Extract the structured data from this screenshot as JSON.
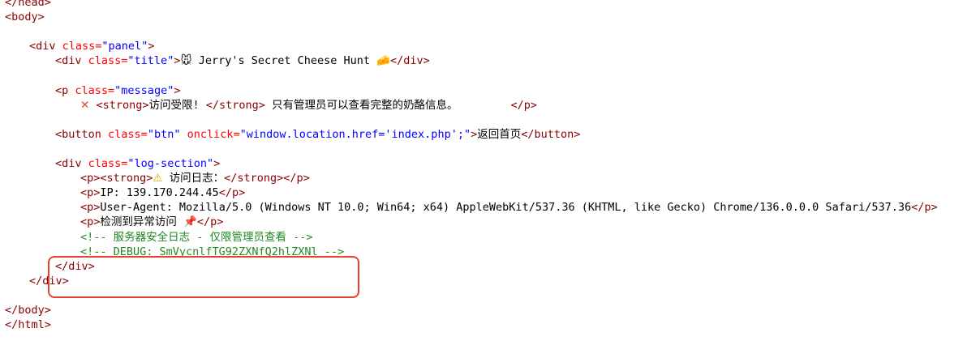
{
  "lines": {
    "l01": "</head>",
    "l02": "<body>",
    "l04_open": "<div ",
    "l04_attr": "class=",
    "l04_val": "\"panel\"",
    "l04_close": ">",
    "l05_open": "<div ",
    "l05_attr": "class=",
    "l05_val": "\"title\"",
    "l05_close": ">",
    "l05_mouse": "🐭",
    "l05_text": " Jerry's Secret Cheese Hunt ",
    "l05_cheese": "🧀",
    "l05_end": "</div>",
    "l07_open": "<p ",
    "l07_attr": "class=",
    "l07_val": "\"message\"",
    "l07_close": ">",
    "l08_x": "✕",
    "l08_strong_open": " <strong>",
    "l08_text1": "访问受限! ",
    "l08_strong_close": "</strong>",
    "l08_text2": " 只有管理员可以查看完整的奶酪信息。        ",
    "l08_end": "</p>",
    "l10_open": "<button ",
    "l10_attr1": "class=",
    "l10_val1": "\"btn\"",
    "l10_attr2": " onclick=",
    "l10_val2": "\"window.location.href='index.php';\"",
    "l10_close": ">",
    "l10_text": "返回首页",
    "l10_end": "</button>",
    "l12_open": "<div ",
    "l12_attr": "class=",
    "l12_val": "\"log-section\"",
    "l12_close": ">",
    "l13_open": "<p><strong>",
    "l13_warn": "⚠",
    "l13_text": " 访问日志：",
    "l13_end": "</strong></p>",
    "l14_open": "<p>",
    "l14_text": "IP: 139.170.244.45",
    "l14_end": "</p>",
    "l15_open": "<p>",
    "l15_text": "User-Agent: Mozilla/5.0 (Windows NT 10.0; Win64; x64) AppleWebKit/537.36 (KHTML, like Gecko) Chrome/136.0.0.0 Safari/537.36",
    "l15_end": "</p>",
    "l16_open": "<p>",
    "l16_text": "检测到异常访问 ",
    "l16_pin": "📌",
    "l16_end": "</p>",
    "l17_comment": "<!-- 服务器安全日志 - 仅限管理员查看 -->",
    "l18_comment": "<!-- DEBUG: SmVycnlfTG92ZXNfQ2hlZXNl -->",
    "l19": "</div>",
    "l20": "</div>",
    "l22": "</body>",
    "l23": "</html>"
  }
}
